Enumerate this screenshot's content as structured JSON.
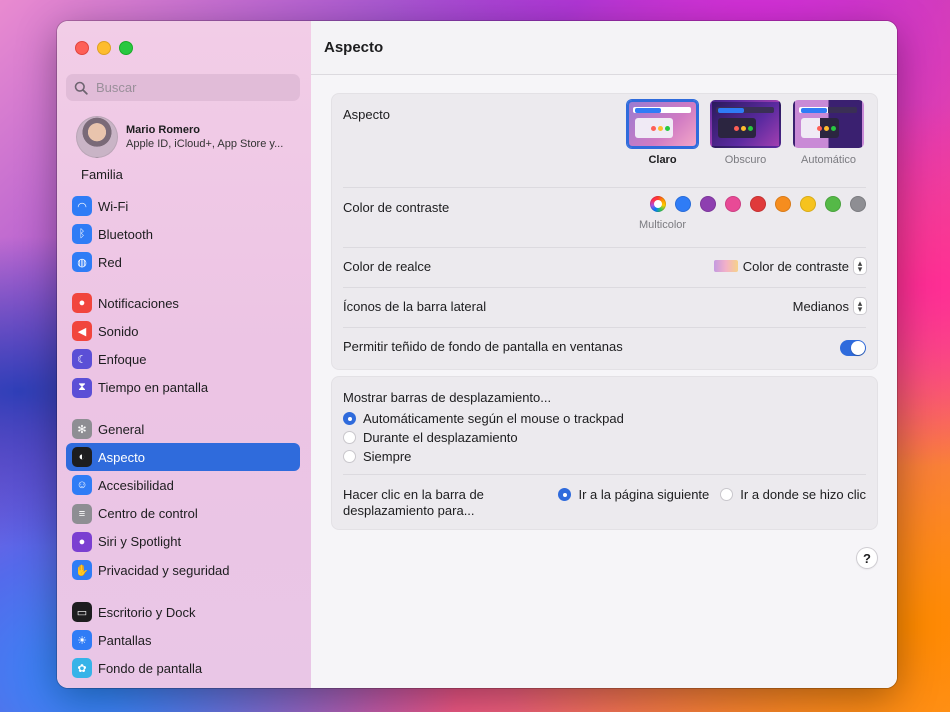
{
  "sidebar": {
    "search_placeholder": "Buscar",
    "user": {
      "name": "Mario Romero",
      "subtitle": "Apple ID, iCloud+, App Store y..."
    },
    "family": "Familia",
    "items": [
      {
        "label": "Wi-Fi",
        "icon": "wifi-icon",
        "color": "#2f7cf6"
      },
      {
        "label": "Bluetooth",
        "icon": "bluetooth-icon",
        "color": "#2f7cf6"
      },
      {
        "label": "Red",
        "icon": "globe-icon",
        "color": "#2f7cf6"
      },
      {
        "label": "Notificaciones",
        "icon": "bell-icon",
        "color": "#f1453d"
      },
      {
        "label": "Sonido",
        "icon": "speaker-icon",
        "color": "#f1453d"
      },
      {
        "label": "Enfoque",
        "icon": "moon-icon",
        "color": "#5b4fd6"
      },
      {
        "label": "Tiempo en pantalla",
        "icon": "hourglass-icon",
        "color": "#5b4fd6"
      },
      {
        "label": "General",
        "icon": "gear-icon",
        "color": "#8e8e93"
      },
      {
        "label": "Aspecto",
        "icon": "appearance-icon",
        "color": "#1d1d1f"
      },
      {
        "label": "Accesibilidad",
        "icon": "accessibility-icon",
        "color": "#2f7cf6"
      },
      {
        "label": "Centro de control",
        "icon": "control-center-icon",
        "color": "#8e8e93"
      },
      {
        "label": "Siri y Spotlight",
        "icon": "siri-icon",
        "color": "#7b3fd1"
      },
      {
        "label": "Privacidad y seguridad",
        "icon": "hand-icon",
        "color": "#2f7cf6"
      },
      {
        "label": "Escritorio y Dock",
        "icon": "dock-icon",
        "color": "#1d1d1f"
      },
      {
        "label": "Pantallas",
        "icon": "sun-icon",
        "color": "#2f7cf6"
      },
      {
        "label": "Fondo de pantalla",
        "icon": "flower-icon",
        "color": "#36b3e8"
      }
    ],
    "active_index": 8
  },
  "main": {
    "title": "Aspecto",
    "appearance": {
      "label": "Aspecto",
      "options": [
        "Claro",
        "Obscuro",
        "Automático"
      ],
      "selected": "Claro"
    },
    "contrast": {
      "label": "Color de contraste",
      "colors": [
        "multicolor",
        "#2f7cf6",
        "#8e3fb0",
        "#e84a96",
        "#e03a3a",
        "#f68d1e",
        "#f6c31e",
        "#55b947",
        "#8e8e93"
      ],
      "caption": "Multicolor"
    },
    "highlight": {
      "label": "Color de realce",
      "value": "Color de contraste"
    },
    "sidebar_icons": {
      "label": "Íconos de la barra lateral",
      "value": "Medianos"
    },
    "tinting": {
      "label": "Permitir teñido de fondo de pantalla en ventanas",
      "on": true
    },
    "scrollbars": {
      "label": "Mostrar barras de desplazamiento...",
      "options": [
        "Automáticamente según el mouse o trackpad",
        "Durante el desplazamiento",
        "Siempre"
      ],
      "selected": 0
    },
    "click_scroll": {
      "label_line1": "Hacer clic en la barra de",
      "label_line2": "desplazamiento para...",
      "options": [
        "Ir a la página siguiente",
        "Ir a donde se hizo clic"
      ],
      "selected": 0
    },
    "help": "?"
  }
}
